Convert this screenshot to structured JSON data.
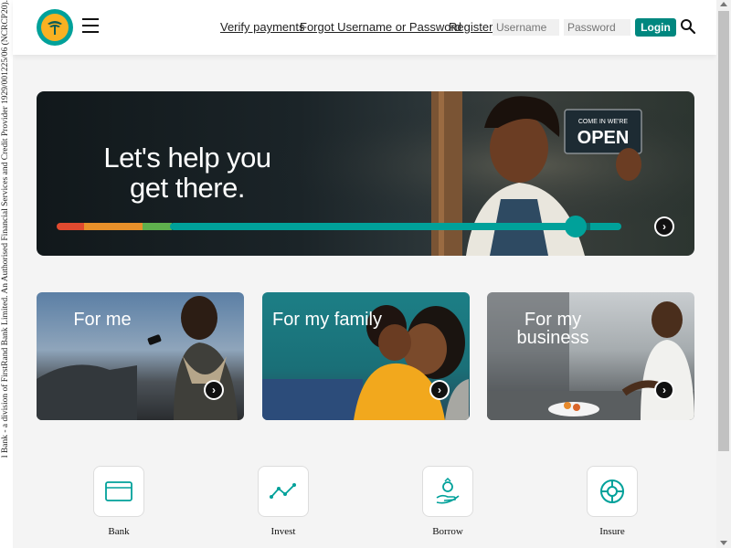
{
  "legal_text": "l Bank - a division of FirstRand Bank Limited. An Authorised Financial Services and Credit Provider 1929/001225/06 (NCRCP20).",
  "header": {
    "links": [
      "Verify payments",
      "Forgot Username or Password",
      "Register"
    ],
    "username_placeholder": "Username",
    "password_placeholder": "Password",
    "login_label": "Login"
  },
  "hero": {
    "title": "Let's help you get there.",
    "sign_small": "COME IN WE'RE",
    "sign_big": "OPEN"
  },
  "cards": [
    {
      "title": "For me"
    },
    {
      "title": "For my family"
    },
    {
      "title": "For my business"
    }
  ],
  "services": [
    {
      "label": "Bank",
      "icon": "card-icon"
    },
    {
      "label": "Invest",
      "icon": "chart-line-icon"
    },
    {
      "label": "Borrow",
      "icon": "hand-ring-icon"
    },
    {
      "label": "Insure",
      "icon": "lifebuoy-icon"
    }
  ],
  "colors": {
    "teal": "#00a19a",
    "login": "#00877f",
    "gold": "#f9b122"
  }
}
